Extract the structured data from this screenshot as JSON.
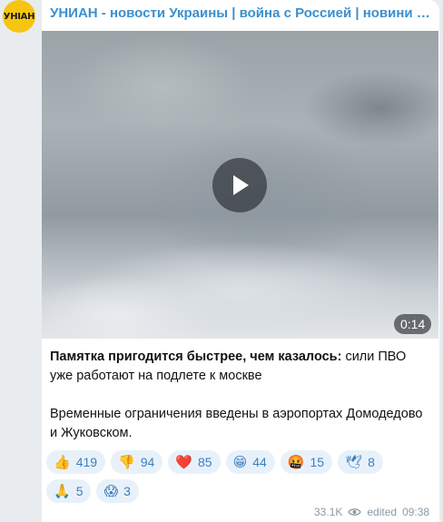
{
  "channel": {
    "name": "УНИАН - новости Украины | война с Россией | новини Украї…",
    "avatar_text": "УНIАН"
  },
  "video": {
    "duration": "0:14"
  },
  "message": {
    "bold_intro": "Памятка пригодится быстрее, чем казалось:",
    "line1_rest": " сили ПВО уже работают на подлете к москве",
    "paragraph2": "Временные ограничения введены в аэропортах Домодедово и Жуковском."
  },
  "reactions": [
    {
      "emoji": "👍",
      "count": "419"
    },
    {
      "emoji": "👎",
      "count": "94"
    },
    {
      "emoji": "❤️",
      "count": "85"
    },
    {
      "emoji": "😁",
      "count": "44"
    },
    {
      "emoji": "🤬",
      "count": "15"
    },
    {
      "emoji": "🕊",
      "count": "8"
    },
    {
      "emoji": "🙏",
      "count": "5"
    },
    {
      "emoji": "😱",
      "count": "3"
    }
  ],
  "meta": {
    "views": "33.1K",
    "edited": "edited",
    "time": "09:38"
  },
  "colors": {
    "accent": "#3a8fd0",
    "reaction_bg": "#e8f1fa",
    "avatar_bg": "#f6c510"
  }
}
